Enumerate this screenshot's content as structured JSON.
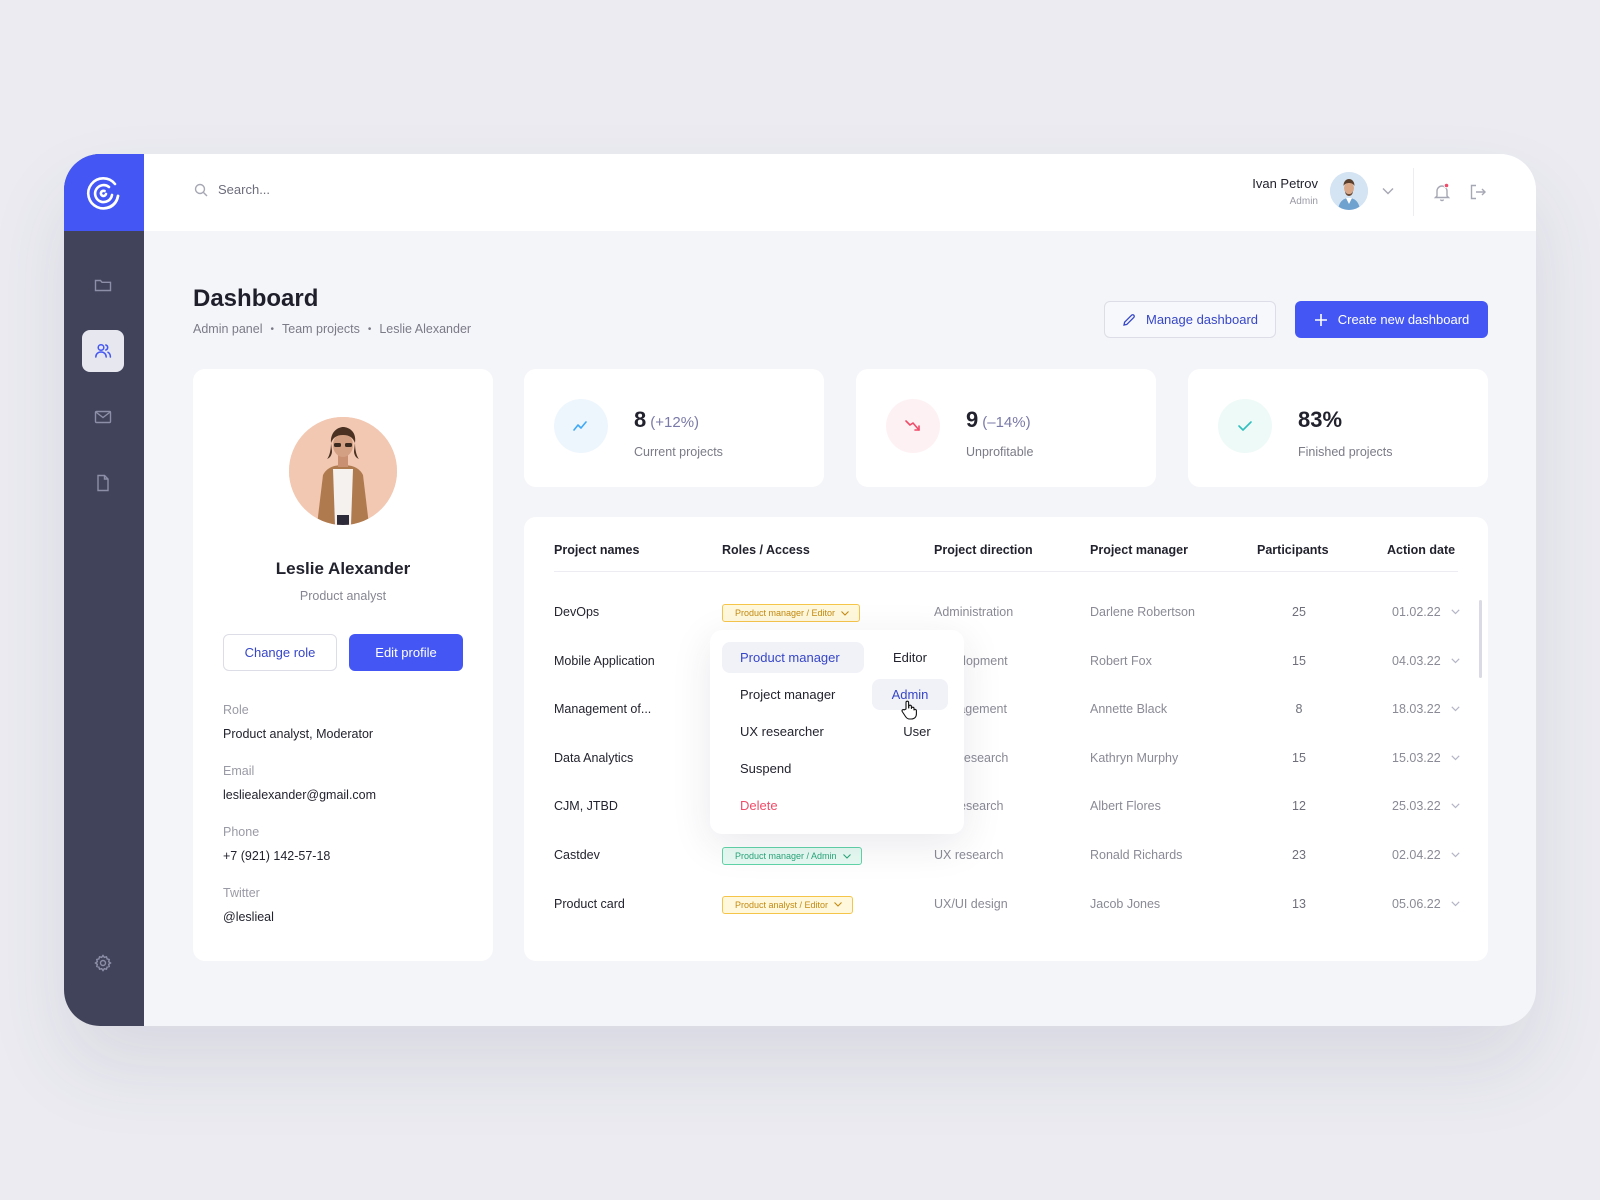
{
  "topbar": {
    "search_placeholder": "Search...",
    "user": {
      "name": "Ivan Petrov",
      "role": "Admin",
      "notification_dot": true
    }
  },
  "sidebar": {
    "items": [
      {
        "name": "projects",
        "icon": "folder-icon",
        "active": false
      },
      {
        "name": "team",
        "icon": "users-icon",
        "active": true
      },
      {
        "name": "messages",
        "icon": "mail-icon",
        "active": false
      },
      {
        "name": "documents",
        "icon": "file-icon",
        "active": false
      }
    ],
    "bottom_icon": "gear-icon"
  },
  "header": {
    "title": "Dashboard",
    "breadcrumb": [
      "Admin panel",
      "Team projects",
      "Leslie Alexander"
    ],
    "manage_label": "Manage dashboard",
    "create_label": "Create new dashboard"
  },
  "profile": {
    "name": "Leslie Alexander",
    "title": "Product analyst",
    "change_role_label": "Change role",
    "edit_profile_label": "Edit profile",
    "fields": [
      {
        "label": "Role",
        "value": "Product analyst, Moderator"
      },
      {
        "label": "Email",
        "value": "lesliealexander@gmail.com"
      },
      {
        "label": "Phone",
        "value": "+7 (921) 142-57-18"
      },
      {
        "label": "Twitter",
        "value": "@leslieal"
      }
    ]
  },
  "stats": [
    {
      "value": "8",
      "change": "(+12%)",
      "label": "Current projects",
      "icon": "trend-up-icon",
      "color": "#3fa9f5",
      "bg": "#eef6fd"
    },
    {
      "value": "9",
      "change": "(–14%)",
      "label": "Unprofitable",
      "icon": "trend-down-icon",
      "color": "#f04c6a",
      "bg": "#fdf1f3"
    },
    {
      "value": "83%",
      "change": "",
      "label": "Finished projects",
      "icon": "check-icon",
      "color": "#2fbfbf",
      "bg": "#eefaf7"
    }
  ],
  "table": {
    "headers": [
      "Project names",
      "Roles / Access",
      "Project direction",
      "Project manager",
      "Participants",
      "Action date"
    ],
    "rows": [
      {
        "name": "DevOps",
        "role": "Product manager / Editor",
        "role_color": "yellow",
        "direction": "Administration",
        "manager": "Darlene Robertson",
        "participants": "25",
        "date": "01.02.22"
      },
      {
        "name": "Mobile Application",
        "role": "",
        "role_color": "",
        "direction": "Development",
        "manager": "Robert Fox",
        "participants": "15",
        "date": "04.03.22"
      },
      {
        "name": "Management of...",
        "role": "",
        "role_color": "",
        "direction": "Management",
        "manager": "Annette Black",
        "participants": "8",
        "date": "18.03.22"
      },
      {
        "name": "Data Analytics",
        "role": "",
        "role_color": "",
        "direction": "UX Research",
        "manager": "Kathryn Murphy",
        "participants": "15",
        "date": "15.03.22"
      },
      {
        "name": "CJM, JTBD",
        "role": "",
        "role_color": "",
        "direction": "UX research",
        "manager": "Albert Flores",
        "participants": "12",
        "date": "25.03.22"
      },
      {
        "name": "Castdev",
        "role": "Product manager / Admin",
        "role_color": "green",
        "direction": "UX research",
        "manager": "Ronald Richards",
        "participants": "23",
        "date": "02.04.22"
      },
      {
        "name": "Product card",
        "role": "Product analyst / Editor",
        "role_color": "yellow",
        "direction": "UX/UI design",
        "manager": "Jacob Jones",
        "participants": "13",
        "date": "05.06.22"
      }
    ]
  },
  "dropdown": {
    "roles": [
      "Product manager",
      "Project manager",
      "UX researcher"
    ],
    "access": [
      "Editor",
      "Admin",
      "User"
    ],
    "selected_role": "Product manager",
    "hovered_access": "Admin",
    "suspend_label": "Suspend",
    "delete_label": "Delete"
  },
  "colors": {
    "accent": "#4457f5",
    "sidebar": "#41435a",
    "danger": "#f04c6a"
  }
}
